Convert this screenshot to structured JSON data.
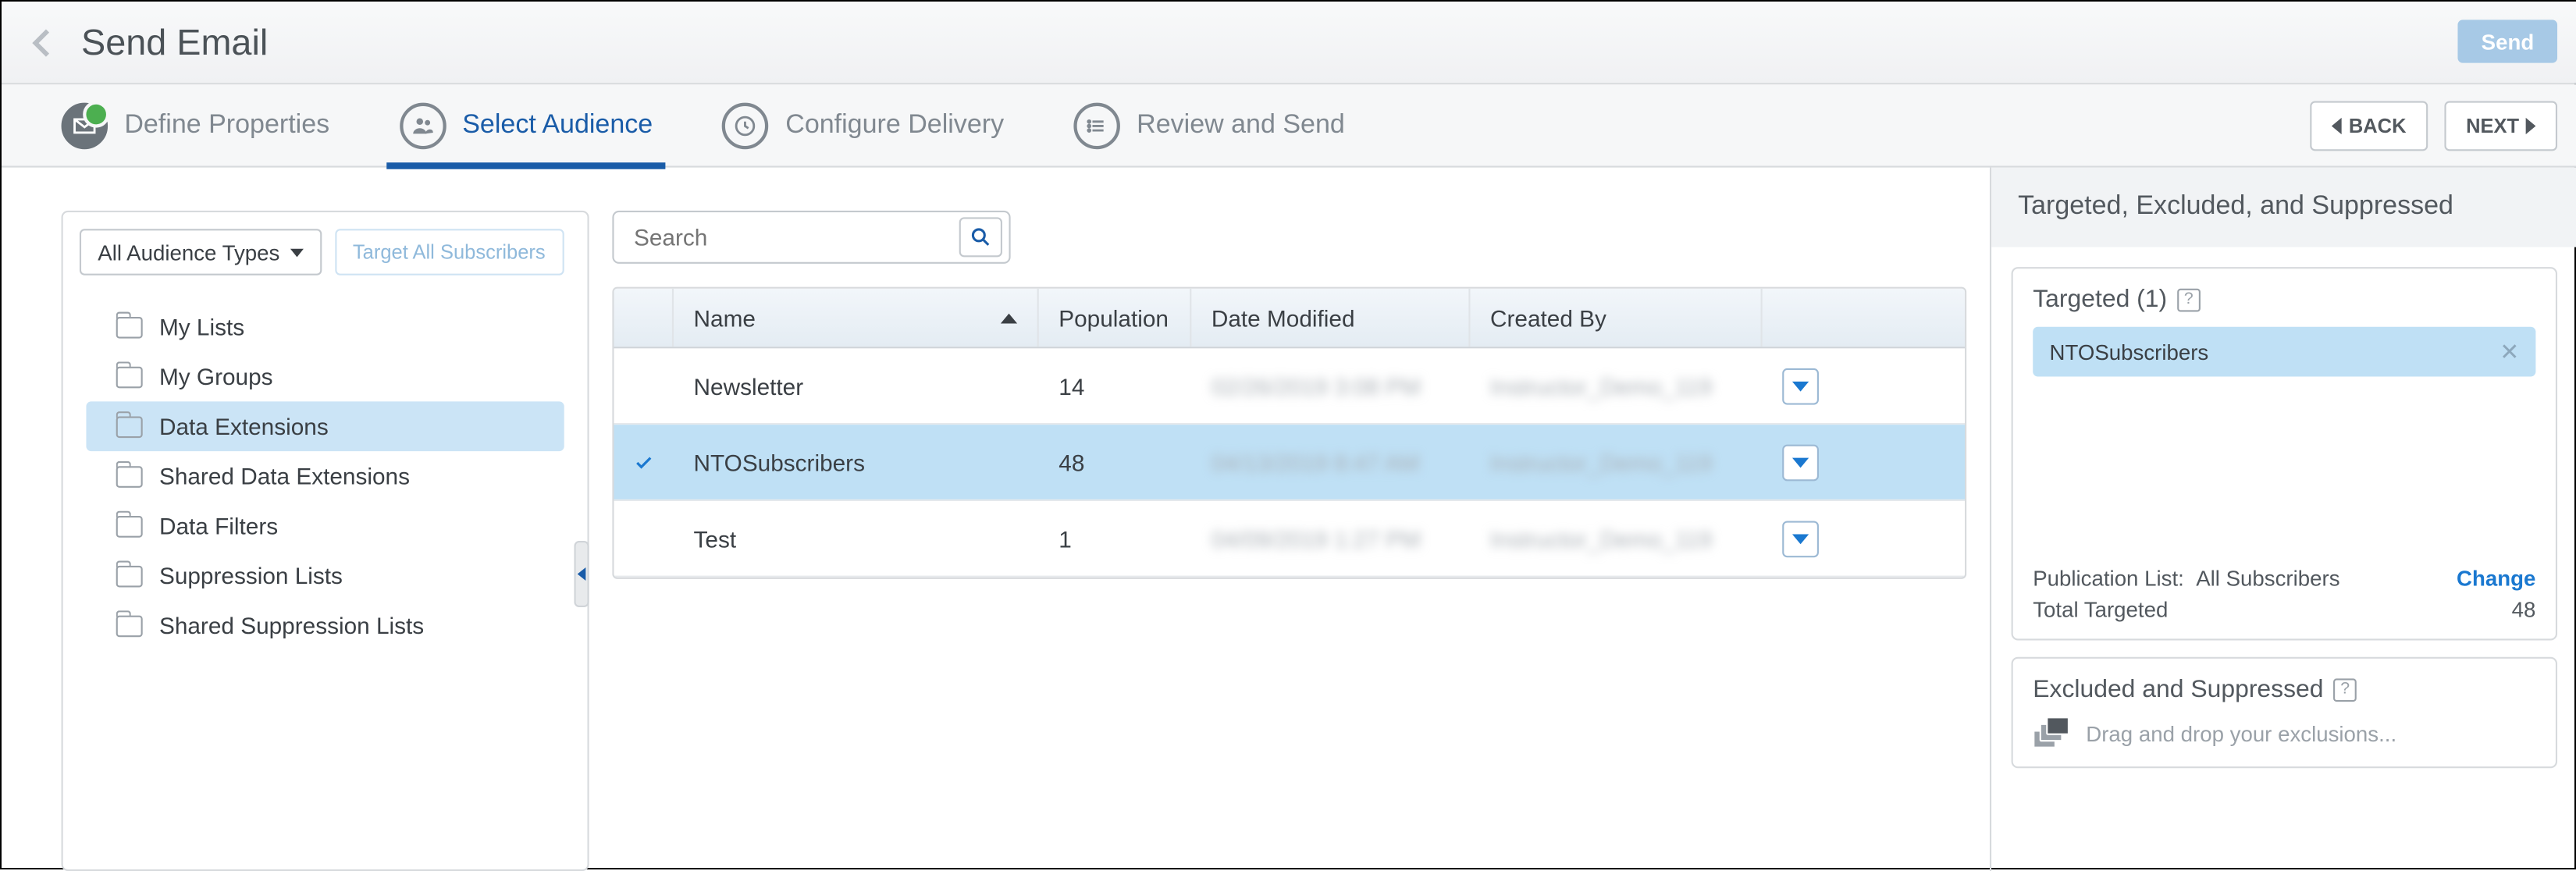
{
  "header": {
    "title": "Send Email",
    "send_label": "Send",
    "back_label": "BACK",
    "next_label": "NEXT"
  },
  "wizard": {
    "steps": [
      {
        "label": "Define Properties"
      },
      {
        "label": "Select Audience"
      },
      {
        "label": "Configure Delivery"
      },
      {
        "label": "Review and Send"
      }
    ]
  },
  "sidebar": {
    "dropdown_label": "All Audience Types",
    "target_all_label": "Target All Subscribers",
    "items": [
      {
        "label": "My Lists"
      },
      {
        "label": "My Groups"
      },
      {
        "label": "Data Extensions"
      },
      {
        "label": "Shared Data Extensions"
      },
      {
        "label": "Data Filters"
      },
      {
        "label": "Suppression Lists"
      },
      {
        "label": "Shared Suppression Lists"
      }
    ],
    "selected_index": 2
  },
  "search": {
    "placeholder": "Search"
  },
  "table": {
    "headers": {
      "name": "Name",
      "population": "Population",
      "date_modified": "Date Modified",
      "created_by": "Created By"
    },
    "rows": [
      {
        "name": "Newsletter",
        "population": "14",
        "date_modified": "02/26/2019 3:08 PM",
        "created_by": "Instructor_Demo_119",
        "selected": false
      },
      {
        "name": "NTOSubscribers",
        "population": "48",
        "date_modified": "04/13/2019 8:47 AM",
        "created_by": "Instructor_Demo_119",
        "selected": true
      },
      {
        "name": "Test",
        "population": "1",
        "date_modified": "04/09/2019 1:27 PM",
        "created_by": "Instructor_Demo_119",
        "selected": false
      }
    ]
  },
  "right": {
    "header": "Targeted, Excluded, and Suppressed",
    "targeted_label": "Targeted (1)",
    "targeted_chip": "NTOSubscribers",
    "pub_list_label": "Publication List:",
    "pub_list_value": "All Subscribers",
    "change_label": "Change",
    "total_targeted_label": "Total Targeted",
    "total_targeted_value": "48",
    "excluded_label": "Excluded and Suppressed",
    "excluded_hint": "Drag and drop your exclusions..."
  }
}
